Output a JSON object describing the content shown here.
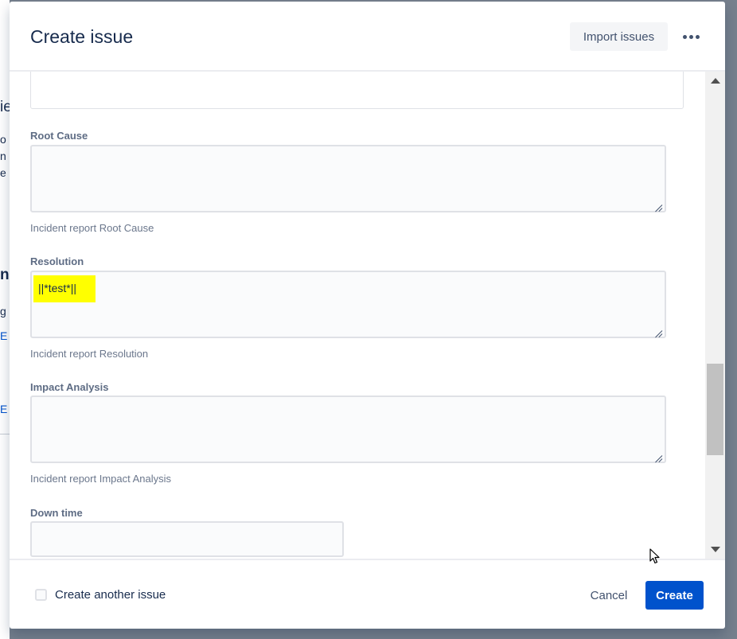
{
  "modal": {
    "title": "Create issue",
    "import_label": "Import issues"
  },
  "fields": {
    "root_cause": {
      "label": "Root Cause",
      "helper": "Incident report Root Cause",
      "value": ""
    },
    "resolution": {
      "label": "Resolution",
      "helper": "Incident report Resolution",
      "value": "||*test*||"
    },
    "impact_analysis": {
      "label": "Impact Analysis",
      "helper": "Incident report Impact Analysis",
      "value": ""
    },
    "down_time": {
      "label": "Down time",
      "value": ""
    }
  },
  "footer": {
    "create_another_label": "Create another issue",
    "create_another_checked": false,
    "cancel_label": "Cancel",
    "create_label": "Create"
  },
  "background_fragments": [
    "ie",
    "o",
    "n",
    "e",
    "n",
    "g",
    "E",
    "E"
  ],
  "colors": {
    "primary": "#0052cc",
    "highlight": "#ffff00",
    "overlay": "#76808d"
  }
}
